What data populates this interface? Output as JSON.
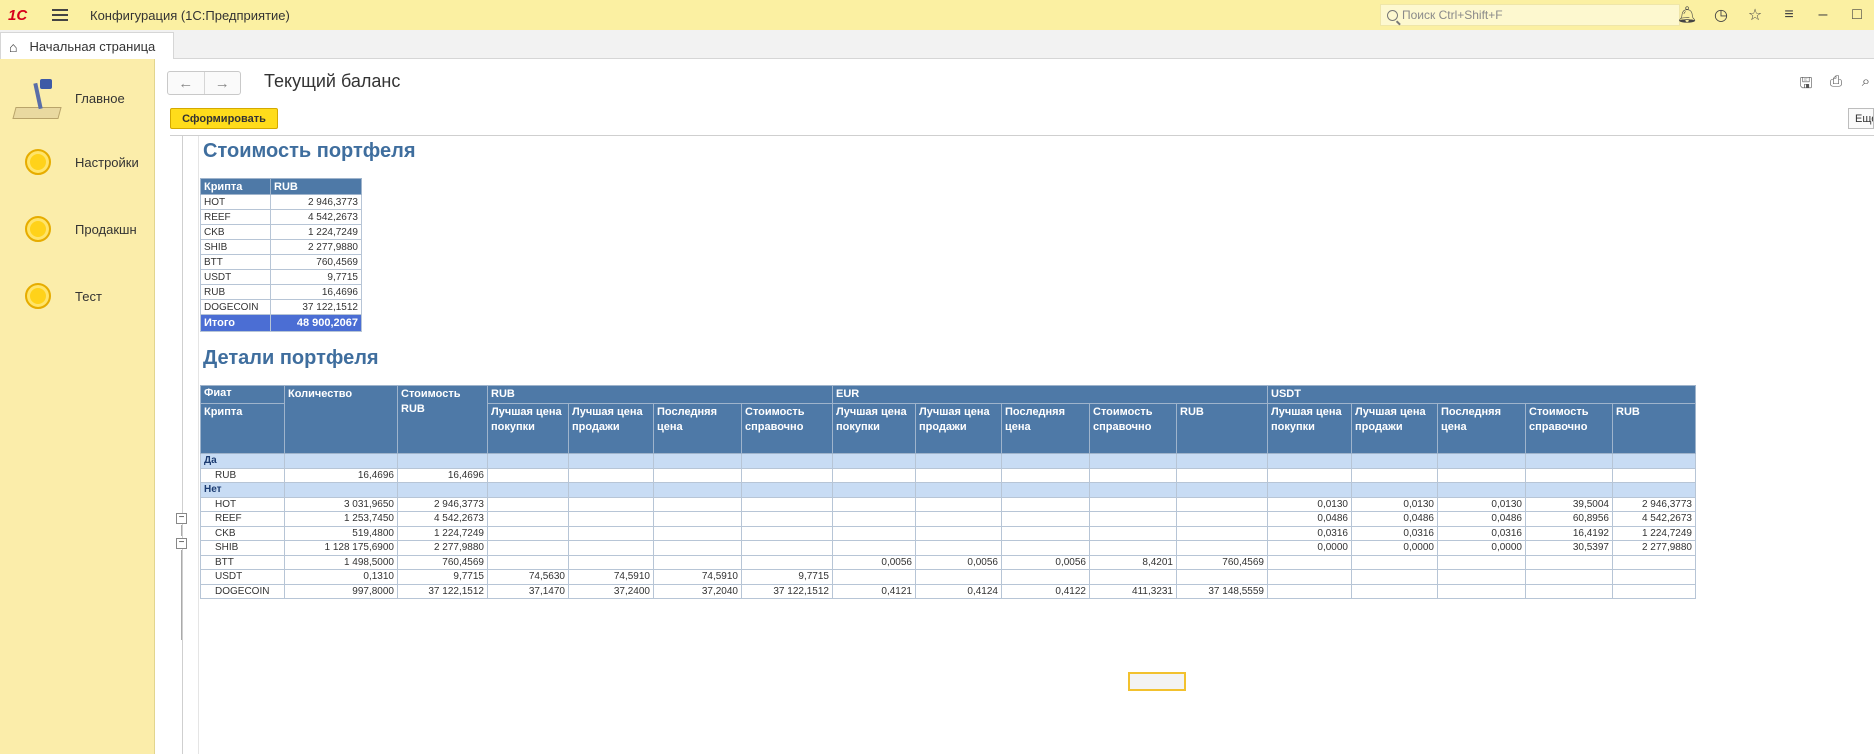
{
  "titlebar": {
    "logo": "1С",
    "app_title": "Конфигурация  (1С:Предприятие)",
    "search_placeholder": "Поиск Ctrl+Shift+F",
    "icons": [
      "bell-icon",
      "history-icon",
      "star-icon",
      "settings-list-icon",
      "minimize-icon",
      "maximize-icon"
    ]
  },
  "tabs": {
    "home_label": "Начальная страница"
  },
  "sidebar": {
    "items": [
      {
        "label": "Главное",
        "icon": "desk-lamp-icon"
      },
      {
        "label": "Настройки",
        "icon": "coin-icon"
      },
      {
        "label": "Продакшн",
        "icon": "coin-icon"
      },
      {
        "label": "Тест",
        "icon": "coin-icon"
      }
    ]
  },
  "main": {
    "title": "Текущий баланс",
    "generate_button": "Сформировать",
    "more_button": "Еще"
  },
  "portfolio": {
    "heading": "Стоимость портфеля",
    "columns": [
      "Крипта",
      "RUB"
    ],
    "rows": [
      [
        "HOT",
        "2 946,3773"
      ],
      [
        "REEF",
        "4 542,2673"
      ],
      [
        "CKB",
        "1 224,7249"
      ],
      [
        "SHIB",
        "2 277,9880"
      ],
      [
        "BTT",
        "760,4569"
      ],
      [
        "USDT",
        "9,7715"
      ],
      [
        "RUB",
        "16,4696"
      ],
      [
        "DOGECOIN",
        "37 122,1512"
      ]
    ],
    "total_label": "Итого",
    "total_value": "48 900,2067"
  },
  "details": {
    "heading": "Детали портфеля",
    "header": {
      "fiat": "Фиат",
      "crypto": "Крипта",
      "quantity": "Количество",
      "value_rub": "Стоимость RUB",
      "groups": [
        "RUB",
        "EUR",
        "USDT"
      ],
      "sub_rub": [
        "Лучшая цена покупки",
        "Лучшая цена продажи",
        "Последняя цена",
        "Стоимость справочно"
      ],
      "sub_other": [
        "Лучшая цена покупки",
        "Лучшая цена продажи",
        "Последняя цена",
        "Стоимость справочно",
        "RUB"
      ]
    },
    "groups": [
      {
        "label": "Да",
        "rows": [
          [
            "RUB",
            "16,4696",
            "16,4696",
            "",
            "",
            "",
            "",
            "",
            "",
            "",
            "",
            "",
            "",
            "",
            "",
            "",
            ""
          ]
        ]
      },
      {
        "label": "Нет",
        "rows": [
          [
            "HOT",
            "3 031,9650",
            "2 946,3773",
            "",
            "",
            "",
            "",
            "",
            "",
            "",
            "",
            "",
            "0,0130",
            "0,0130",
            "0,0130",
            "39,5004",
            "2 946,3773"
          ],
          [
            "REEF",
            "1 253,7450",
            "4 542,2673",
            "",
            "",
            "",
            "",
            "",
            "",
            "",
            "",
            "",
            "0,0486",
            "0,0486",
            "0,0486",
            "60,8956",
            "4 542,2673"
          ],
          [
            "CKB",
            "519,4800",
            "1 224,7249",
            "",
            "",
            "",
            "",
            "",
            "",
            "",
            "",
            "",
            "0,0316",
            "0,0316",
            "0,0316",
            "16,4192",
            "1 224,7249"
          ],
          [
            "SHIB",
            "1 128 175,6900",
            "2 277,9880",
            "",
            "",
            "",
            "",
            "",
            "",
            "",
            "",
            "",
            "0,0000",
            "0,0000",
            "0,0000",
            "30,5397",
            "2 277,9880"
          ],
          [
            "BTT",
            "1 498,5000",
            "760,4569",
            "",
            "",
            "",
            "",
            "0,0056",
            "0,0056",
            "0,0056",
            "8,4201",
            "760,4569",
            "",
            "",
            "",
            "",
            ""
          ],
          [
            "USDT",
            "0,1310",
            "9,7715",
            "74,5630",
            "74,5910",
            "74,5910",
            "9,7715",
            "",
            "",
            "",
            "",
            "",
            "",
            "",
            "",
            "",
            ""
          ],
          [
            "DOGECOIN",
            "997,8000",
            "37 122,1512",
            "37,1470",
            "37,2400",
            "37,2040",
            "37 122,1512",
            "0,4121",
            "0,4124",
            "0,4122",
            "411,3231",
            "37 148,5559",
            "",
            "",
            "",
            "",
            ""
          ]
        ]
      }
    ]
  }
}
